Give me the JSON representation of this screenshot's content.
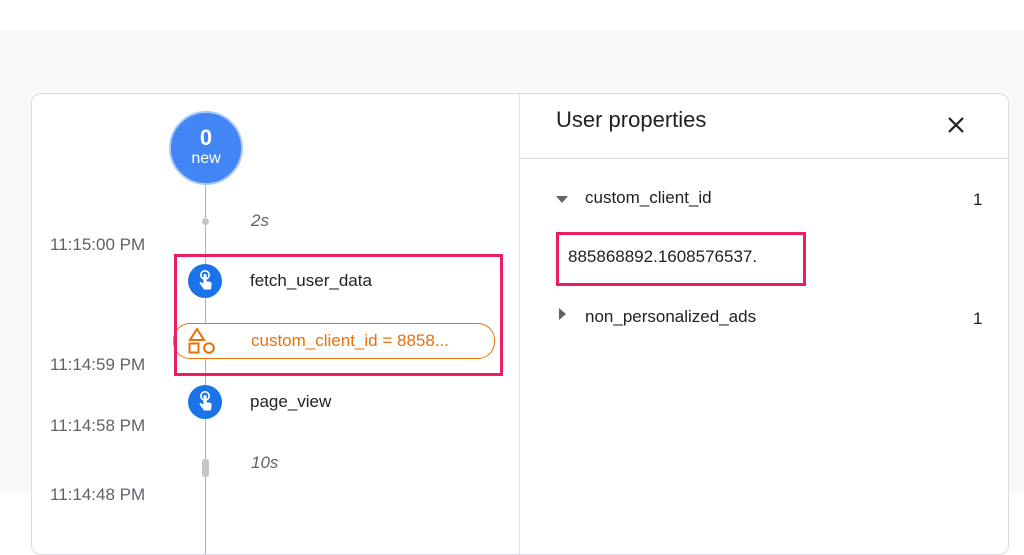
{
  "timeline": {
    "new_count": "0",
    "new_label": "new",
    "gap_top": "2s",
    "gap_bottom": "10s",
    "times": [
      "11:15:00 PM",
      "11:14:59 PM",
      "11:14:58 PM",
      "11:14:48 PM"
    ],
    "events": [
      {
        "label": "fetch_user_data",
        "icon": "touch-icon"
      },
      {
        "label": "page_view",
        "icon": "touch-icon"
      }
    ],
    "property_change": {
      "text": "custom_client_id = 8858...",
      "icon": "shapes-icon"
    }
  },
  "panel": {
    "title": "User properties",
    "close_icon": "close-icon",
    "properties": [
      {
        "name": "custom_client_id",
        "count": "1",
        "expanded": true,
        "value": "885868892.1608576537."
      },
      {
        "name": "non_personalized_ads",
        "count": "1",
        "expanded": false
      }
    ]
  },
  "colors": {
    "highlight": "#e91e63",
    "event_icon": "#1a73e8",
    "new_circle": "#4285f4",
    "property_accent": "#e8710a"
  }
}
